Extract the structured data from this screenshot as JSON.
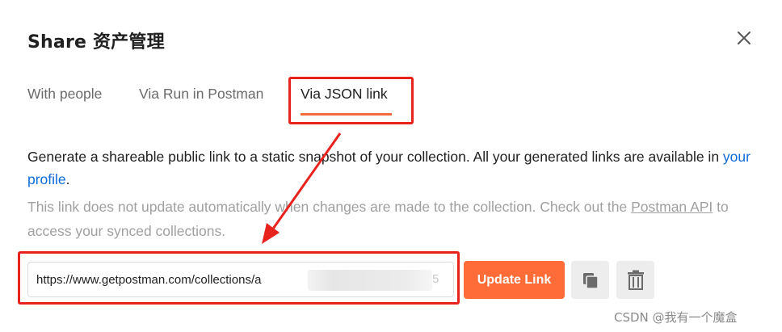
{
  "dialog": {
    "title": "Share 资产管理",
    "close_icon": "close-icon"
  },
  "tabs": [
    {
      "label": "With people",
      "active": false
    },
    {
      "label": "Via Run in Postman",
      "active": false
    },
    {
      "label": "Via JSON link",
      "active": true
    }
  ],
  "description": {
    "text_before_link": "Generate a shareable public link to a static snapshot of your collection. All your generated links are available in ",
    "link_text": "your profile",
    "text_after_link": "."
  },
  "note": {
    "text_before_link": "This link does not update automatically when changes are made to the collection. Check out the ",
    "link_text": "Postman API",
    "text_after_link": " to access your synced collections."
  },
  "share_link": {
    "url_visible": "https://www.getpostman.com/collections/a",
    "url_tail": "5"
  },
  "actions": {
    "update_label": "Update Link",
    "copy_icon": "copy-icon",
    "delete_icon": "trash-icon"
  },
  "colors": {
    "accent": "#ff6c37",
    "tab_underline": "#f26b3a",
    "link": "#0f6bd8",
    "annotation": "#e8221c"
  },
  "watermark": "CSDN @我有一个魔盒"
}
